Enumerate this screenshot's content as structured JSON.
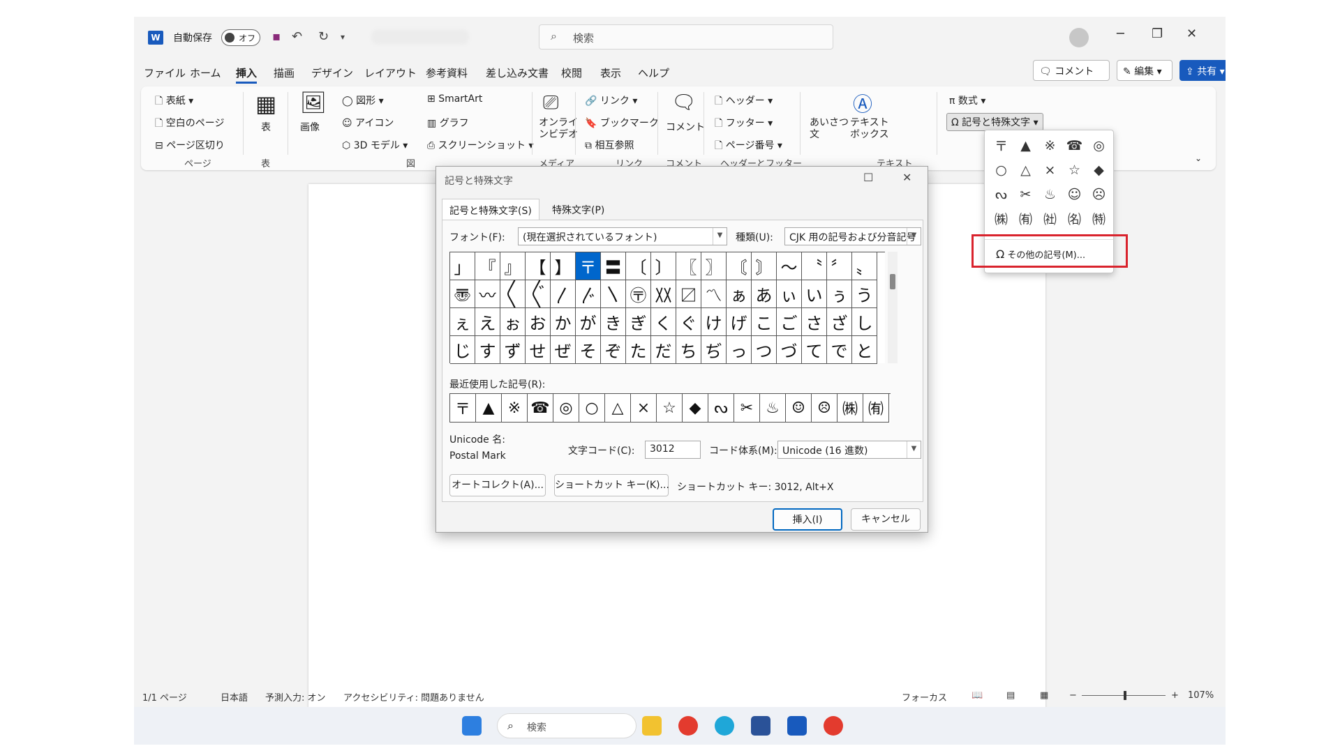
{
  "titlebar": {
    "autosave_label": "自動保存",
    "toggle_label": "オフ",
    "search_placeholder": "検索"
  },
  "menu": [
    "ファイル",
    "ホーム",
    "挿入",
    "描画",
    "デザイン",
    "レイアウト",
    "参考資料",
    "差し込み文書",
    "校閲",
    "表示",
    "ヘルプ"
  ],
  "menu_active": "挿入",
  "right_buttons": {
    "comment": "コメント",
    "edit": "編集",
    "share": "共有"
  },
  "ribbon": {
    "cover": "表紙",
    "blank_page": "空白のページ",
    "page_break": "ページ区切り",
    "grp_page": "ページ",
    "table": "表",
    "grp_table": "表",
    "picture": "画像",
    "shapes": "図形",
    "icons": "アイコン",
    "models3d": "3D モデル",
    "smartart": "SmartArt",
    "graph": "グラフ",
    "screenshot": "スクリーンショット",
    "grp_illust": "図",
    "online_video": "オンライ\nンビデオ",
    "grp_media": "メディア",
    "link": "リンク",
    "bookmark": "ブックマーク",
    "crossref": "相互参照",
    "grp_link": "リンク",
    "comment": "コメント",
    "grp_comment": "コメント",
    "header": "ヘッダー",
    "footer": "フッター",
    "page_number": "ページ番号",
    "grp_hf": "ヘッダーとフッター",
    "greeting": "あいさつ\n文",
    "textbox": "テキスト\nボックス",
    "grp_text": "テキスト",
    "equation": "数式",
    "symbol": "記号と特殊文字"
  },
  "dropdown": {
    "symbols": [
      "〒",
      "▲",
      "※",
      "☎",
      "◎",
      "○",
      "△",
      "×",
      "☆",
      "◆",
      "ᔓ",
      "✂",
      "♨",
      "☺",
      "☹",
      "㈱",
      "㈲",
      "㈳",
      "㈴",
      "㈵"
    ],
    "more_label": "その他の記号(M)..."
  },
  "dialog": {
    "title": "記号と特殊文字",
    "tab1": "記号と特殊文字(S)",
    "tab2": "特殊文字(P)",
    "font_label": "フォント(F):",
    "font_value": "(現在選択されているフォント)",
    "subset_label": "種類(U):",
    "subset_value": "CJK 用の記号および分音記号",
    "grid": [
      "」",
      "『",
      "』",
      "【",
      "】",
      "〒",
      "〓",
      "〔",
      "〕",
      "〖",
      "〗",
      "〘",
      "〙",
      "〜",
      "〝",
      "〞",
      "〟",
      "〠",
      "〰",
      "〱",
      "〲",
      "〳",
      "〴",
      "〵",
      "〶",
      "〷",
      "〼",
      "〽",
      "ぁ",
      "あ",
      "ぃ",
      "い",
      "ぅ",
      "う",
      "ぇ",
      "え",
      "ぉ",
      "お",
      "か",
      "が",
      "き",
      "ぎ",
      "く",
      "ぐ",
      "け",
      "げ",
      "こ",
      "ご",
      "さ",
      "ざ",
      "し",
      "じ",
      "す",
      "ず",
      "せ",
      "ぜ",
      "そ",
      "ぞ",
      "た",
      "だ",
      "ち",
      "ぢ",
      "っ",
      "つ",
      "づ",
      "て",
      "で",
      "と"
    ],
    "selected_char": "〒",
    "recent_label": "最近使用した記号(R):",
    "recent": [
      "〒",
      "▲",
      "※",
      "☎",
      "◎",
      "○",
      "△",
      "×",
      "☆",
      "◆",
      "ᔓ",
      "✂",
      "♨",
      "☺",
      "☹",
      "㈱",
      "㈲"
    ],
    "unicode_name_label": "Unicode 名:",
    "unicode_name": "Postal Mark",
    "char_code_label": "文字コード(C):",
    "char_code": "3012",
    "from_label": "コード体系(M):",
    "from_value": "Unicode (16 進数)",
    "autocorrect": "オートコレクト(A)...",
    "shortcut_key": "ショートカット キー(K)...",
    "shortcut_text": "ショートカット キー: 3012, Alt+X",
    "insert": "挿入(I)",
    "cancel": "キャンセル"
  },
  "status": {
    "page": "1/1 ページ",
    "lang": "日本語",
    "predict": "予測入力: オン",
    "accessibility": "アクセシビリティ: 問題ありません",
    "focus": "フォーカス",
    "zoom": "107%"
  },
  "taskbar": {
    "search": "検索"
  }
}
